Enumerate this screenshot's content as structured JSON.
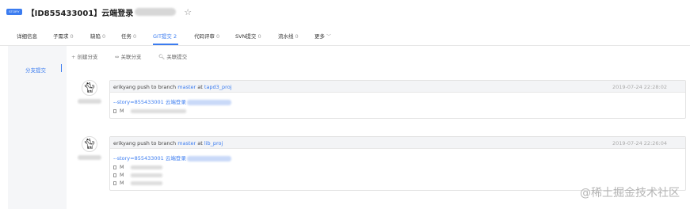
{
  "header": {
    "badge": "STORY",
    "title": "【ID855433001】云端登录"
  },
  "tabs": [
    {
      "label": "详细信息",
      "count": ""
    },
    {
      "label": "子需求",
      "count": "0"
    },
    {
      "label": "缺陷",
      "count": "0"
    },
    {
      "label": "任务",
      "count": "0"
    },
    {
      "label": "GIT提交",
      "count": "2"
    },
    {
      "label": "代码评审",
      "count": "0"
    },
    {
      "label": "SVN提交",
      "count": "0"
    },
    {
      "label": "流水线",
      "count": "0"
    },
    {
      "label": "更多",
      "count": ""
    }
  ],
  "sidebar": {
    "items": [
      {
        "label": "分支提交"
      }
    ]
  },
  "toolbar": {
    "create_branch": "创建分支",
    "link_branch": "关联分支",
    "link_commit": "关联提交"
  },
  "commits": [
    {
      "author": "erikyang",
      "action": "push to branch",
      "branch": "master",
      "at": "at",
      "repo": "tapd3_proj",
      "time": "2019-07-24 22:28:02",
      "story": "--story=855433001 云端登录",
      "files": [
        {
          "mark": "M"
        }
      ]
    },
    {
      "author": "erikyang",
      "action": "push to branch",
      "branch": "master",
      "at": "at",
      "repo": "lib_proj",
      "time": "2019-07-24 22:26:04",
      "story": "--story=855433001 云端登录",
      "files": [
        {
          "mark": "M"
        },
        {
          "mark": "M"
        },
        {
          "mark": "M"
        }
      ]
    }
  ],
  "watermark": "@稀土掘金技术社区"
}
